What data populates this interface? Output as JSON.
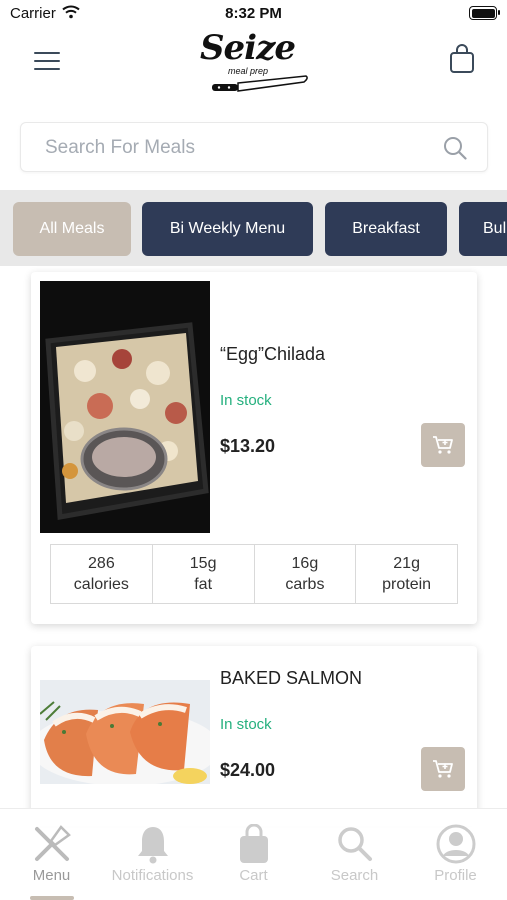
{
  "status_bar": {
    "carrier": "Carrier",
    "time": "8:32 PM"
  },
  "header": {
    "logo_text": "Seize",
    "logo_subtext": "meal prep",
    "menu_icon": "hamburger-menu-icon",
    "bag_icon": "shopping-bag-icon"
  },
  "search": {
    "placeholder": "Search For Meals",
    "value": "",
    "icon": "search-icon"
  },
  "categories": [
    {
      "label": "All Meals",
      "active": true
    },
    {
      "label": "Bi Weekly Menu",
      "active": false
    },
    {
      "label": "Breakfast",
      "active": false
    },
    {
      "label": "Bul",
      "active": false
    }
  ],
  "products": [
    {
      "name": "“Egg”Chilada",
      "stock": "In stock",
      "price": "$13.20",
      "nutrition": [
        {
          "value": "286",
          "label": "calories"
        },
        {
          "value": "15g",
          "label": "fat"
        },
        {
          "value": "16g",
          "label": "carbs"
        },
        {
          "value": "21g",
          "label": "protein"
        }
      ]
    },
    {
      "name": "BAKED SALMON",
      "stock": "In stock",
      "price": "$24.00"
    }
  ],
  "tabs": [
    {
      "label": "Menu",
      "icon": "fork-knife-icon",
      "active": true
    },
    {
      "label": "Notifications",
      "icon": "bell-icon",
      "active": false
    },
    {
      "label": "Cart",
      "icon": "bag-icon",
      "active": false
    },
    {
      "label": "Search",
      "icon": "search-icon",
      "active": false
    },
    {
      "label": "Profile",
      "icon": "profile-icon",
      "active": false
    }
  ],
  "colors": {
    "accent": "#c7bdb2",
    "navy": "#2f3b57",
    "stock_green": "#25b07e",
    "tab_inactive": "#c8c8c8"
  }
}
